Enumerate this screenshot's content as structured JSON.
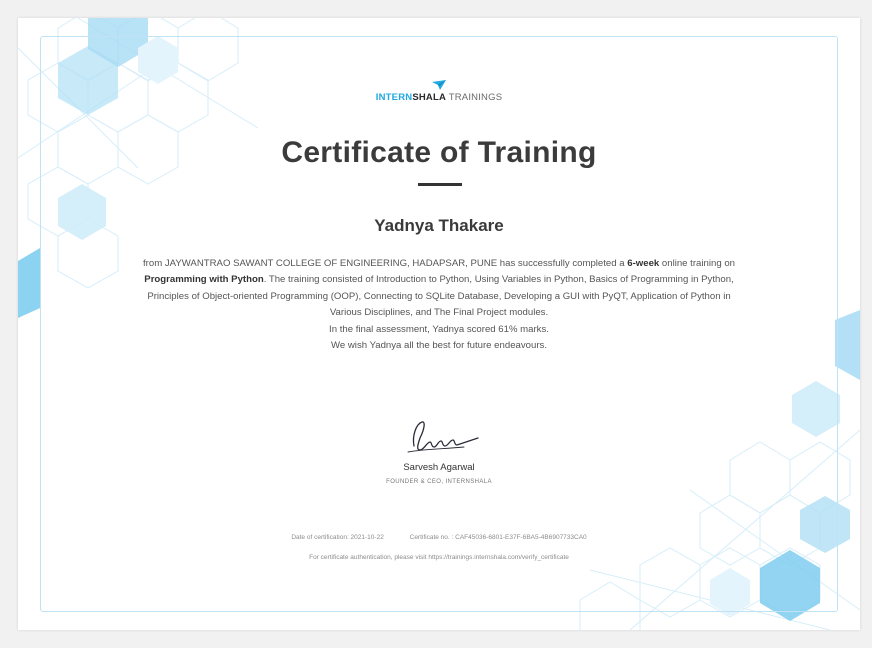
{
  "logo": {
    "brand_primary": "INTERN",
    "brand_secondary": "SHALA",
    "brand_suffix": "TRAININGS",
    "icon": "paper-plane-icon"
  },
  "certificate": {
    "title": "Certificate of Training",
    "recipient": "Yadnya Thakare",
    "body": {
      "p1_intro": "from JAYWANTRAO SAWANT COLLEGE OF ENGINEERING, HADAPSAR, PUNE has successfully completed a ",
      "p1_duration": "6-week",
      "p1_mid": " online training on ",
      "p1_course": "Programming with Python",
      "p1_rest": ". The training consisted of Introduction to Python, Using Variables in Python, Basics of Programming in Python, Principles of Object-oriented Programming (OOP), Connecting to SQLite Database, Developing a GUI with PyQT, Application of Python in Various Disciplines, and The Final Project modules.",
      "assessment": "In the final assessment, Yadnya scored 61% marks.",
      "wish": "We wish Yadnya all the best for future endeavours."
    },
    "signer": {
      "name": "Sarvesh Agarwal",
      "title": "FOUNDER & CEO, INTERNSHALA"
    },
    "meta": {
      "date": "Date of certification: 2021-10-22",
      "certificate_no": "Certificate no. : CAF45036-6801-E37F-6BA5-4B6907733CA0"
    },
    "verify_text": "For certificate authentication, please visit https://trainings.internshala.com/verify_certificate"
  },
  "colors": {
    "accent": "#1fa8e1",
    "frame": "#bfe3f4",
    "hex_light": "#e3f4fc",
    "hex_mid": "#b4e1f6",
    "hex_dark": "#7fcdef"
  }
}
